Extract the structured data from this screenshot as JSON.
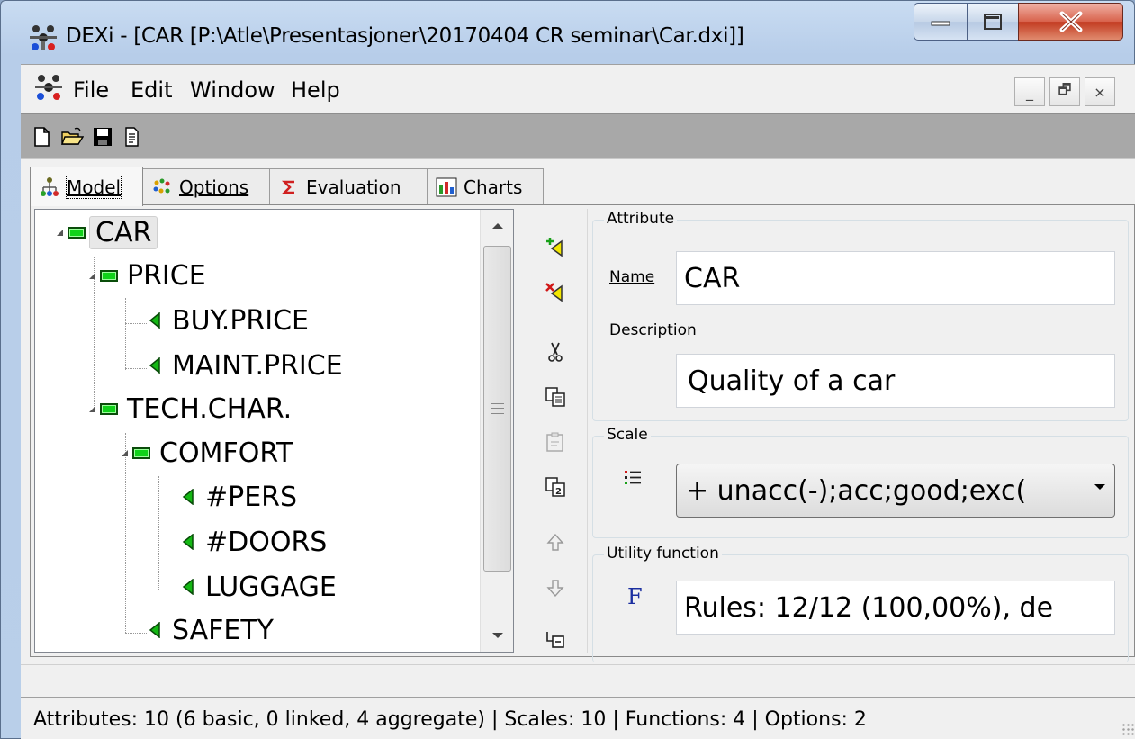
{
  "window": {
    "title": "DEXi - [CAR [P:\\Atle\\Presentasjoner\\20170404 CR seminar\\Car.dxi]]"
  },
  "menu": {
    "file": "File",
    "edit": "Edit",
    "window": "Window",
    "help": "Help"
  },
  "mdi_controls": [
    "_",
    "🗗",
    "×"
  ],
  "tabs": [
    {
      "label": "Model",
      "icon": "model-tree-icon"
    },
    {
      "label": "Options",
      "icon": "options-dots-icon"
    },
    {
      "label": "Evaluation",
      "icon": "sigma-icon"
    },
    {
      "label": "Charts",
      "icon": "chart-icon"
    }
  ],
  "tree": [
    {
      "label": "CAR",
      "kind": "aggregate",
      "level": 0,
      "selected": true
    },
    {
      "label": "PRICE",
      "kind": "aggregate",
      "level": 1
    },
    {
      "label": "BUY.PRICE",
      "kind": "basic",
      "level": 2
    },
    {
      "label": "MAINT.PRICE",
      "kind": "basic",
      "level": 2
    },
    {
      "label": "TECH.CHAR.",
      "kind": "aggregate",
      "level": 1
    },
    {
      "label": "COMFORT",
      "kind": "aggregate",
      "level": 2
    },
    {
      "label": "#PERS",
      "kind": "basic",
      "level": 3
    },
    {
      "label": "#DOORS",
      "kind": "basic",
      "level": 3
    },
    {
      "label": "LUGGAGE",
      "kind": "basic",
      "level": 3
    },
    {
      "label": "SAFETY",
      "kind": "basic",
      "level": 2
    }
  ],
  "attribute": {
    "group_title": "Attribute",
    "name_label": "Name",
    "name_value": "CAR",
    "description_label": "Description",
    "description_value": "Quality of a car"
  },
  "scale": {
    "group_title": "Scale",
    "value": "+ unacc(-);acc;good;exc("
  },
  "utility": {
    "group_title": "Utility function",
    "icon_letter": "F",
    "value": "Rules: 12/12 (100,00%), de"
  },
  "status": {
    "text": "Attributes: 10 (6 basic, 0 linked, 4 aggregate)  |  Scales: 10  |  Functions: 4  |  Options: 2"
  },
  "colors": {
    "aggregate_node": "#10d21a",
    "basic_node": "#14b814",
    "close_button": "#c8442c",
    "toolbar_bg": "#a8a8a8"
  }
}
